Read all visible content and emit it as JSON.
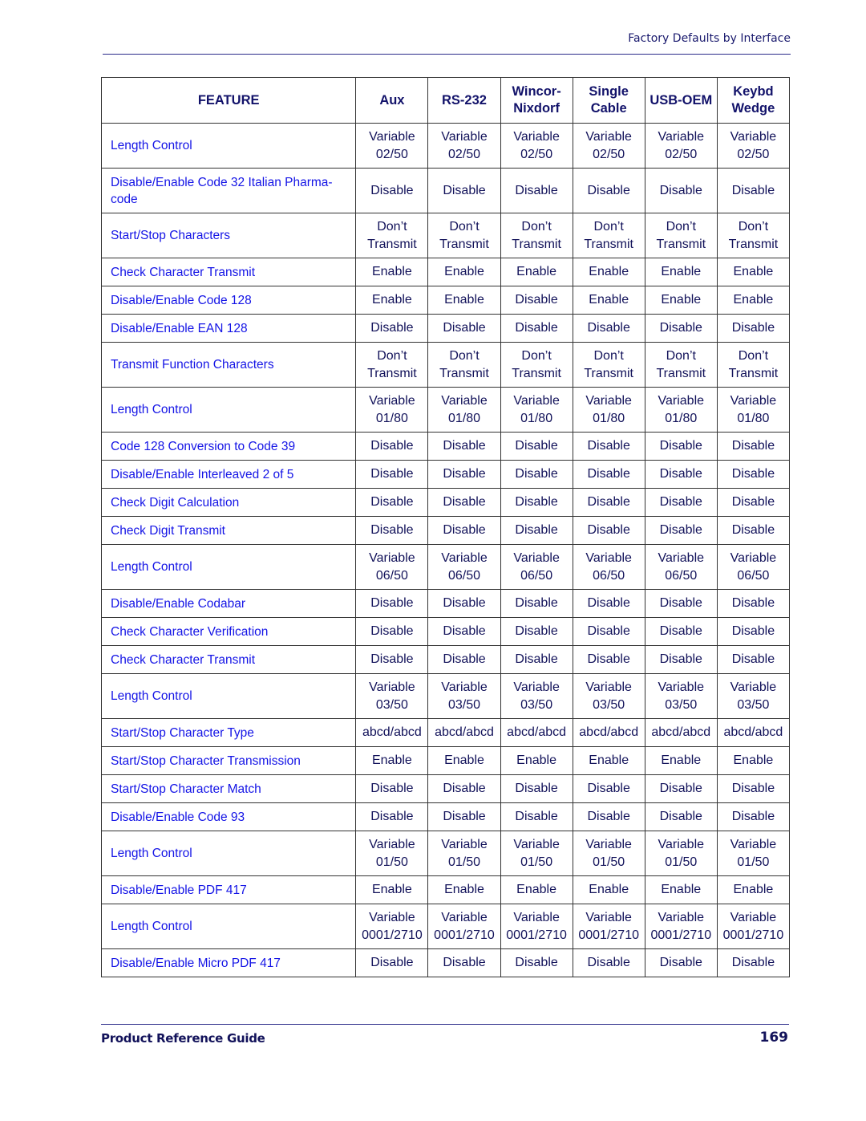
{
  "header": {
    "title": "Factory Defaults by Interface"
  },
  "table": {
    "columns": [
      {
        "lines": [
          "FEATURE"
        ]
      },
      {
        "lines": [
          "Aux"
        ]
      },
      {
        "lines": [
          "RS-232"
        ]
      },
      {
        "lines": [
          "Wincor-",
          "Nixdorf"
        ]
      },
      {
        "lines": [
          "Single",
          "Cable"
        ]
      },
      {
        "lines": [
          "USB-OEM"
        ]
      },
      {
        "lines": [
          "Keybd",
          "Wedge"
        ]
      }
    ],
    "rows": [
      {
        "feature": [
          "Length Control"
        ],
        "tall": true,
        "values": [
          [
            "Variable",
            "02/50"
          ],
          [
            "Variable",
            "02/50"
          ],
          [
            "Variable",
            "02/50"
          ],
          [
            "Variable",
            "02/50"
          ],
          [
            "Variable",
            "02/50"
          ],
          [
            "Variable",
            "02/50"
          ]
        ]
      },
      {
        "feature": [
          "Disable/Enable Code 32 Italian Pharma-",
          "code"
        ],
        "tall": true,
        "values": [
          [
            "Disable"
          ],
          [
            "Disable"
          ],
          [
            "Disable"
          ],
          [
            "Disable"
          ],
          [
            "Disable"
          ],
          [
            "Disable"
          ]
        ]
      },
      {
        "feature": [
          "Start/Stop Characters"
        ],
        "tall": true,
        "values": [
          [
            "Don’t",
            "Transmit"
          ],
          [
            "Don’t",
            "Transmit"
          ],
          [
            "Don’t",
            "Transmit"
          ],
          [
            "Don’t",
            "Transmit"
          ],
          [
            "Don’t",
            "Transmit"
          ],
          [
            "Don’t",
            "Transmit"
          ]
        ]
      },
      {
        "feature": [
          "Check Character Transmit"
        ],
        "tall": false,
        "values": [
          [
            "Enable"
          ],
          [
            "Enable"
          ],
          [
            "Enable"
          ],
          [
            "Enable"
          ],
          [
            "Enable"
          ],
          [
            "Enable"
          ]
        ]
      },
      {
        "feature": [
          "Disable/Enable Code 128"
        ],
        "tall": false,
        "values": [
          [
            "Enable"
          ],
          [
            "Enable"
          ],
          [
            "Disable"
          ],
          [
            "Enable"
          ],
          [
            "Enable"
          ],
          [
            "Enable"
          ]
        ]
      },
      {
        "feature": [
          "Disable/Enable EAN 128"
        ],
        "tall": false,
        "values": [
          [
            "Disable"
          ],
          [
            "Disable"
          ],
          [
            "Disable"
          ],
          [
            "Disable"
          ],
          [
            "Disable"
          ],
          [
            "Disable"
          ]
        ]
      },
      {
        "feature": [
          "Transmit Function Characters"
        ],
        "tall": true,
        "values": [
          [
            "Don’t",
            "Transmit"
          ],
          [
            "Don’t",
            "Transmit"
          ],
          [
            "Don’t",
            "Transmit"
          ],
          [
            "Don’t",
            "Transmit"
          ],
          [
            "Don’t",
            "Transmit"
          ],
          [
            "Don’t",
            "Transmit"
          ]
        ]
      },
      {
        "feature": [
          "Length Control"
        ],
        "tall": true,
        "values": [
          [
            "Variable",
            "01/80"
          ],
          [
            "Variable",
            "01/80"
          ],
          [
            "Variable",
            "01/80"
          ],
          [
            "Variable",
            "01/80"
          ],
          [
            "Variable",
            "01/80"
          ],
          [
            "Variable",
            "01/80"
          ]
        ]
      },
      {
        "feature": [
          "Code 128 Conversion to Code 39"
        ],
        "tall": false,
        "values": [
          [
            "Disable"
          ],
          [
            "Disable"
          ],
          [
            "Disable"
          ],
          [
            "Disable"
          ],
          [
            "Disable"
          ],
          [
            "Disable"
          ]
        ]
      },
      {
        "feature": [
          "Disable/Enable Interleaved 2 of 5"
        ],
        "tall": false,
        "values": [
          [
            "Disable"
          ],
          [
            "Disable"
          ],
          [
            "Disable"
          ],
          [
            "Disable"
          ],
          [
            "Disable"
          ],
          [
            "Disable"
          ]
        ]
      },
      {
        "feature": [
          "Check Digit Calculation"
        ],
        "tall": false,
        "values": [
          [
            "Disable"
          ],
          [
            "Disable"
          ],
          [
            "Disable"
          ],
          [
            "Disable"
          ],
          [
            "Disable"
          ],
          [
            "Disable"
          ]
        ]
      },
      {
        "feature": [
          "Check Digit Transmit"
        ],
        "tall": false,
        "values": [
          [
            "Disable"
          ],
          [
            "Disable"
          ],
          [
            "Disable"
          ],
          [
            "Disable"
          ],
          [
            "Disable"
          ],
          [
            "Disable"
          ]
        ]
      },
      {
        "feature": [
          "Length Control"
        ],
        "tall": true,
        "values": [
          [
            "Variable",
            "06/50"
          ],
          [
            "Variable",
            "06/50"
          ],
          [
            "Variable",
            "06/50"
          ],
          [
            "Variable",
            "06/50"
          ],
          [
            "Variable",
            "06/50"
          ],
          [
            "Variable",
            "06/50"
          ]
        ]
      },
      {
        "feature": [
          "Disable/Enable Codabar"
        ],
        "tall": false,
        "values": [
          [
            "Disable"
          ],
          [
            "Disable"
          ],
          [
            "Disable"
          ],
          [
            "Disable"
          ],
          [
            "Disable"
          ],
          [
            "Disable"
          ]
        ]
      },
      {
        "feature": [
          "Check Character Verification"
        ],
        "tall": false,
        "values": [
          [
            "Disable"
          ],
          [
            "Disable"
          ],
          [
            "Disable"
          ],
          [
            "Disable"
          ],
          [
            "Disable"
          ],
          [
            "Disable"
          ]
        ]
      },
      {
        "feature": [
          "Check Character Transmit"
        ],
        "tall": false,
        "values": [
          [
            "Disable"
          ],
          [
            "Disable"
          ],
          [
            "Disable"
          ],
          [
            "Disable"
          ],
          [
            "Disable"
          ],
          [
            "Disable"
          ]
        ]
      },
      {
        "feature": [
          "Length Control"
        ],
        "tall": true,
        "values": [
          [
            "Variable",
            "03/50"
          ],
          [
            "Variable",
            "03/50"
          ],
          [
            "Variable",
            "03/50"
          ],
          [
            "Variable",
            "03/50"
          ],
          [
            "Variable",
            "03/50"
          ],
          [
            "Variable",
            "03/50"
          ]
        ]
      },
      {
        "feature": [
          "Start/Stop Character Type"
        ],
        "tall": false,
        "values": [
          [
            "abcd/abcd"
          ],
          [
            "abcd/abcd"
          ],
          [
            "abcd/abcd"
          ],
          [
            "abcd/abcd"
          ],
          [
            "abcd/abcd"
          ],
          [
            "abcd/abcd"
          ]
        ]
      },
      {
        "feature": [
          "Start/Stop Character Transmission"
        ],
        "tall": false,
        "values": [
          [
            "Enable"
          ],
          [
            "Enable"
          ],
          [
            "Enable"
          ],
          [
            "Enable"
          ],
          [
            "Enable"
          ],
          [
            "Enable"
          ]
        ]
      },
      {
        "feature": [
          "Start/Stop Character Match"
        ],
        "tall": false,
        "values": [
          [
            "Disable"
          ],
          [
            "Disable"
          ],
          [
            "Disable"
          ],
          [
            "Disable"
          ],
          [
            "Disable"
          ],
          [
            "Disable"
          ]
        ]
      },
      {
        "feature": [
          "Disable/Enable Code 93"
        ],
        "tall": false,
        "values": [
          [
            "Disable"
          ],
          [
            "Disable"
          ],
          [
            "Disable"
          ],
          [
            "Disable"
          ],
          [
            "Disable"
          ],
          [
            "Disable"
          ]
        ]
      },
      {
        "feature": [
          "Length Control"
        ],
        "tall": true,
        "values": [
          [
            "Variable",
            "01/50"
          ],
          [
            "Variable",
            "01/50"
          ],
          [
            "Variable",
            "01/50"
          ],
          [
            "Variable",
            "01/50"
          ],
          [
            "Variable",
            "01/50"
          ],
          [
            "Variable",
            "01/50"
          ]
        ]
      },
      {
        "feature": [
          "Disable/Enable PDF 417"
        ],
        "tall": false,
        "values": [
          [
            "Enable"
          ],
          [
            "Enable"
          ],
          [
            "Enable"
          ],
          [
            "Enable"
          ],
          [
            "Enable"
          ],
          [
            "Enable"
          ]
        ]
      },
      {
        "feature": [
          "Length Control"
        ],
        "tall": true,
        "values": [
          [
            "Variable",
            "0001/2710"
          ],
          [
            "Variable",
            "0001/2710"
          ],
          [
            "Variable",
            "0001/2710"
          ],
          [
            "Variable",
            "0001/2710"
          ],
          [
            "Variable",
            "0001/2710"
          ],
          [
            "Variable",
            "0001/2710"
          ]
        ]
      },
      {
        "feature": [
          "Disable/Enable Micro PDF 417"
        ],
        "tall": false,
        "values": [
          [
            "Disable"
          ],
          [
            "Disable"
          ],
          [
            "Disable"
          ],
          [
            "Disable"
          ],
          [
            "Disable"
          ],
          [
            "Disable"
          ]
        ]
      }
    ]
  },
  "footer": {
    "guide_title": "Product Reference Guide",
    "page_number": "169"
  },
  "colors": {
    "feature_link": "#1414e6",
    "heading": "#12126a",
    "rule": "#2b2b8a"
  }
}
